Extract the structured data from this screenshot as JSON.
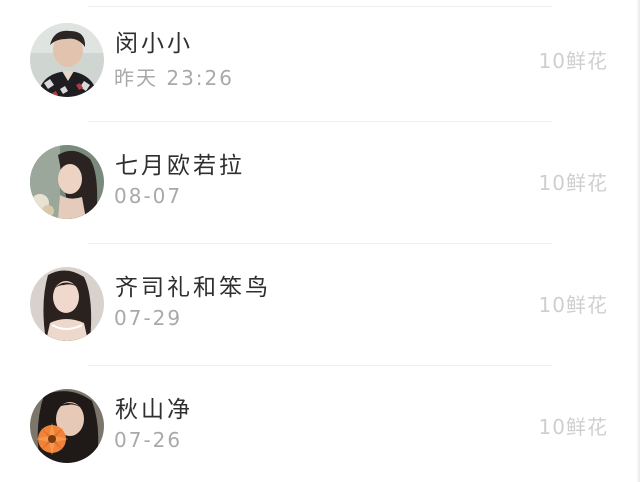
{
  "list": {
    "items": [
      {
        "name": "闵小小",
        "time": "昨天 23:26",
        "flowers": "10鲜花",
        "avatar": "avatar-photo-1"
      },
      {
        "name": "七月欧若拉",
        "time": "08-07",
        "flowers": "10鲜花",
        "avatar": "avatar-photo-2"
      },
      {
        "name": "齐司礼和笨鸟",
        "time": "07-29",
        "flowers": "10鲜花",
        "avatar": "avatar-photo-3"
      },
      {
        "name": "秋山净",
        "time": "07-26",
        "flowers": "10鲜花",
        "avatar": "avatar-photo-4"
      }
    ]
  }
}
